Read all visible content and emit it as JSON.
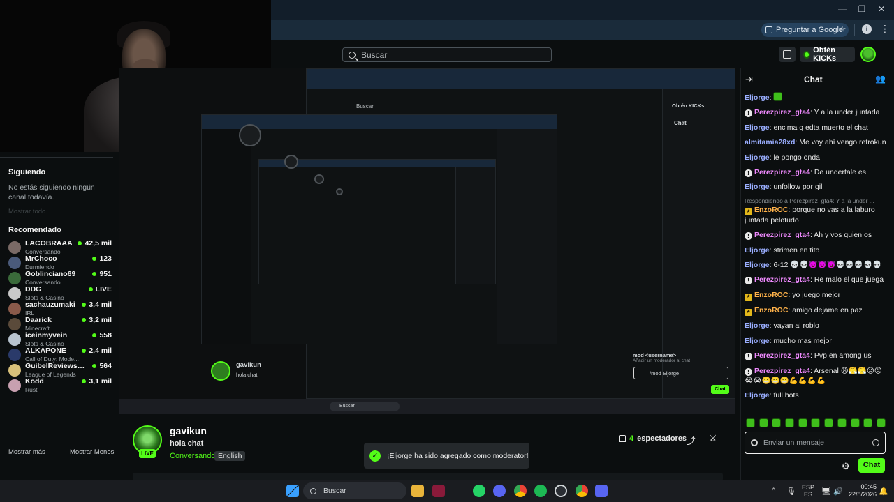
{
  "browser": {
    "ask_google": "Preguntar a Google",
    "window_controls": [
      "minimize-icon",
      "restore-icon",
      "close-icon"
    ]
  },
  "header": {
    "search_placeholder": "Buscar",
    "kicks_label": "Obtén KICKs"
  },
  "sidebar": {
    "following_title": "Siguiendo",
    "following_empty": "No estás siguiendo ningún canal todavía.",
    "show_all": "Mostrar todo",
    "recommended_title": "Recomendado",
    "items": [
      {
        "name": "LACOBRAAA",
        "category": "Conversando",
        "viewers": "42,5 mil",
        "color": "#7a6a66"
      },
      {
        "name": "MrChoco",
        "category": "Durmiendo",
        "viewers": "123",
        "color": "#4a5a7a"
      },
      {
        "name": "Goblinciano69",
        "category": "Conversando",
        "viewers": "951",
        "color": "#3a6a3a"
      },
      {
        "name": "DDG",
        "category": "Slots & Casino",
        "viewers": "LIVE",
        "color": "#c9c9c9"
      },
      {
        "name": "sachauzumaki",
        "category": "IRL",
        "viewers": "3,4 mil",
        "color": "#8a5a4a"
      },
      {
        "name": "Daarick",
        "category": "Minecraft",
        "viewers": "3,2 mil",
        "color": "#5a4a3a"
      },
      {
        "name": "iceinmyvein",
        "category": "Slots & Casino",
        "viewers": "558",
        "color": "#b8c4d0"
      },
      {
        "name": "ALKAPONE",
        "category": "Call of Duty: Mode...",
        "viewers": "2,4 mil",
        "color": "#2a3a6a"
      },
      {
        "name": "GuibelReviewsDir...",
        "category": "League of Legends",
        "viewers": "564",
        "color": "#d8c07a"
      },
      {
        "name": "Kodd",
        "category": "Rust",
        "viewers": "3,1 mil",
        "color": "#c8a0b0"
      }
    ],
    "show_more": "Mostrar más",
    "show_less": "Mostrar Menos"
  },
  "stream": {
    "streamer": "gavikun",
    "title": "hola chat",
    "category": "Conversando",
    "language": "English",
    "live": "LIVE",
    "viewers_count": "4",
    "viewers_label": "espectadores"
  },
  "toast": {
    "message": "¡Eljorge ha sido agregado como moderator!"
  },
  "chat": {
    "title": "Chat",
    "messages": [
      {
        "user": "Eljorge",
        "color": "#9aaeff",
        "text": "",
        "emote": true
      },
      {
        "user": "Perezpirez_gta4",
        "color": "#f08aff",
        "badge": "mod",
        "text": "Y a la under juntada"
      },
      {
        "user": "Eljorge",
        "color": "#9aaeff",
        "text": "encima q edta muerto el chat"
      },
      {
        "user": "almitamia28xd",
        "color": "#9aaeff",
        "text": "Me voy ahí vengo retrokun"
      },
      {
        "user": "Eljorge",
        "color": "#9aaeff",
        "text": "le pongo onda"
      },
      {
        "user": "Perezpirez_gta4",
        "color": "#f08aff",
        "badge": "mod",
        "text": "De undertale es"
      },
      {
        "user": "Eljorge",
        "color": "#9aaeff",
        "text": "unfollow por gil"
      },
      {
        "reply": "Respondiendo a Perezpirez_gta4: Y a la under ...",
        "user": "EnzoROC",
        "color": "#ffb24a",
        "badge": "sub",
        "text": "porque no vas a la laburo juntada pelotudo"
      },
      {
        "user": "Perezpirez_gta4",
        "color": "#f08aff",
        "badge": "mod",
        "text": "Ah y vos quien os"
      },
      {
        "user": "Eljorge",
        "color": "#9aaeff",
        "text": "strimen en tito"
      },
      {
        "user": "Eljorge",
        "color": "#9aaeff",
        "text": "6-12 💀💀👿👿👿💀💀💀💀💀"
      },
      {
        "user": "Perezpirez_gta4",
        "color": "#f08aff",
        "badge": "mod",
        "text": "Re malo el que juega"
      },
      {
        "user": "EnzoROC",
        "color": "#ffb24a",
        "badge": "sub",
        "text": "yo juego mejor"
      },
      {
        "user": "EnzoROC",
        "color": "#ffb24a",
        "badge": "sub",
        "text": "amigo dejame en paz"
      },
      {
        "user": "Eljorge",
        "color": "#9aaeff",
        "text": "vayan al roblo"
      },
      {
        "user": "Eljorge",
        "color": "#9aaeff",
        "text": "mucho mas mejor"
      },
      {
        "user": "Perezpirez_gta4",
        "color": "#f08aff",
        "badge": "mod",
        "text": "Pvp en among us"
      },
      {
        "user": "Perezpirez_gta4",
        "color": "#f08aff",
        "badge": "mod",
        "text": "Arsenal 😩😤😤😥😡😭😭😬😬😬💪💪💪💪"
      },
      {
        "user": "Eljorge",
        "color": "#9aaeff",
        "text": "full bots"
      }
    ],
    "input_placeholder": "Enviar un mensaje",
    "send_label": "Chat"
  },
  "nested": {
    "search_placeholder": "Buscar",
    "kicks_label": "Obtén KICKs",
    "chat_title": "Chat",
    "mod_command": "/mod Eljorge",
    "mod_hint": "mod <username>",
    "mod_sub": "Añadir un moderador al chat"
  },
  "taskbar": {
    "search": "Buscar",
    "lang_top": "ESP",
    "lang_bottom": "ES",
    "time": "00:45",
    "date": "22/8/2026"
  }
}
